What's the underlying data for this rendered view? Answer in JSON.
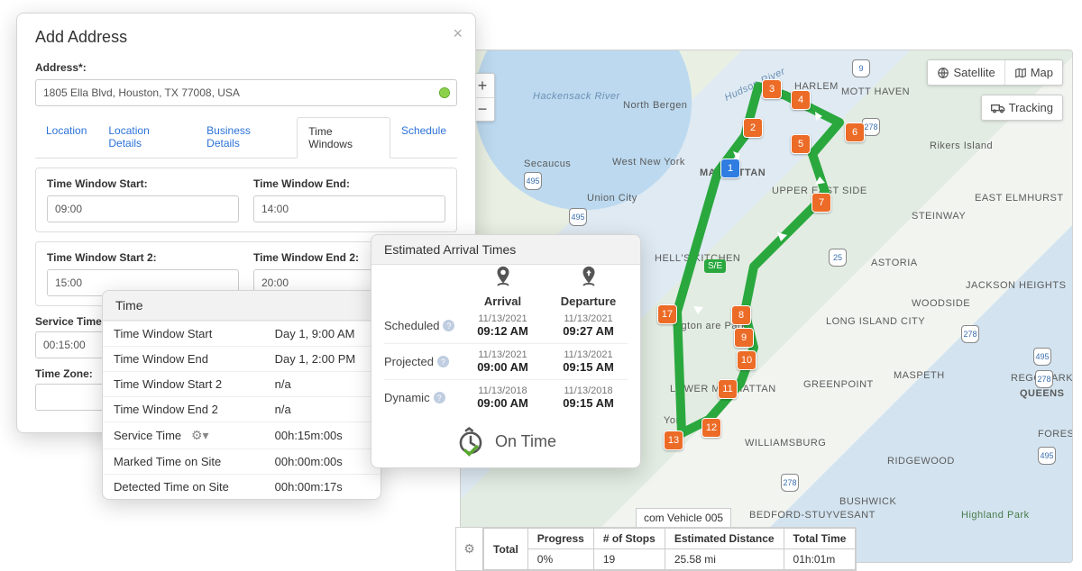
{
  "modal": {
    "title": "Add Address",
    "address_label": "Address*:",
    "address_value": "1805 Ella Blvd, Houston, TX 77008, USA",
    "tabs": {
      "location": "Location",
      "location_details": "Location Details",
      "business_details": "Business Details",
      "time_windows": "Time Windows",
      "schedule": "Schedule"
    },
    "tw1": {
      "start_label": "Time Window Start:",
      "start_value": "09:00",
      "end_label": "Time Window End:",
      "end_value": "14:00"
    },
    "tw2": {
      "start_label": "Time Window Start 2:",
      "start_value": "15:00",
      "end_label": "Time Window End 2:",
      "end_value": "20:00"
    },
    "service_time_label": "Service Time (HH:MM:SS):",
    "service_time_value": "00:15:00",
    "time_zone_label": "Time Zone:"
  },
  "time_card": {
    "title": "Time",
    "rows": {
      "tw_start": {
        "label": "Time Window Start",
        "value": "Day 1, 9:00 AM"
      },
      "tw_end": {
        "label": "Time Window End",
        "value": "Day 1, 2:00 PM"
      },
      "tw_start2": {
        "label": "Time Window Start 2",
        "value": "n/a"
      },
      "tw_end2": {
        "label": "Time Window End 2",
        "value": "n/a"
      },
      "service": {
        "label": "Service Time",
        "value": "00h:15m:00s"
      },
      "marked": {
        "label": "Marked Time on Site",
        "value": "00h:00m:00s"
      },
      "detected": {
        "label": "Detected Time on Site",
        "value": "00h:00m:17s"
      }
    }
  },
  "eta": {
    "title": "Estimated Arrival Times",
    "arrival_label": "Arrival",
    "departure_label": "Departure",
    "scheduled_label": "Scheduled",
    "projected_label": "Projected",
    "dynamic_label": "Dynamic",
    "scheduled": {
      "arr_date": "11/13/2021",
      "arr_time": "09:12 AM",
      "dep_date": "11/13/2021",
      "dep_time": "09:27 AM"
    },
    "projected": {
      "arr_date": "11/13/2021",
      "arr_time": "09:00 AM",
      "dep_date": "11/13/2021",
      "dep_time": "09:15 AM"
    },
    "dynamic": {
      "arr_date": "11/13/2018",
      "arr_time": "09:00 AM",
      "dep_date": "11/13/2018",
      "dep_time": "09:15 AM"
    },
    "status": "On Time"
  },
  "map": {
    "satellite": "Satellite",
    "map": "Map",
    "tracking": "Tracking",
    "vehicle": "com Vehicle 005",
    "labels": {
      "hackensack": "Hackensack River",
      "north_bergen": "North Bergen",
      "secaucus": "Secaucus",
      "west_ny": "West New York",
      "union_city": "Union City",
      "manhattan": "MANHATTAN",
      "astoria": "ASTORIA",
      "queens": "QUEENS",
      "rikers": "Rikers Island",
      "licity": "LONG ISLAND CITY",
      "harlem": "HARLEM",
      "mott_haven": "MOTT HAVEN",
      "east_elm": "EAST ELMHURST",
      "steinway": "STEINWAY",
      "jackson": "JACKSON HEIGHTS",
      "woodside": "WOODSIDE",
      "williamsburg": "WILLIAMSBURG",
      "ridgewood": "RIDGEWOOD",
      "maspeth": "MASPETH",
      "greenpoint": "GREENPOINT",
      "lower_man": "LOWER MANHATTAN",
      "york": "York",
      "hells_kitchen": "HELL'S KITCHEN",
      "upper_east": "UPPER EAST SIDE",
      "hudson": "Hudson River",
      "ington_park": "ington are Park",
      "bed_stuy": "BEDFORD-STUYVESANT",
      "bushwick": "BUSHWICK",
      "hp": "Highland Park",
      "forest": "FOREST",
      "rego": "REGO PARK"
    },
    "stops": {
      "1": "1",
      "2": "2",
      "3": "3",
      "4": "4",
      "5": "5",
      "6": "6",
      "7": "7",
      "8": "8",
      "9": "9",
      "10": "10",
      "11": "11",
      "12": "12",
      "13": "13",
      "17": "17",
      "se": "S/E"
    }
  },
  "summary": {
    "total_label": "Total",
    "headers": {
      "progress": "Progress",
      "stops": "# of Stops",
      "dist": "Estimated Distance",
      "time": "Total Time"
    },
    "values": {
      "progress": "0%",
      "stops": "19",
      "dist": "25.58 mi",
      "time": "01h:01m"
    }
  },
  "shields": {
    "s1": "9",
    "s2": "495",
    "s3": "495",
    "s4": "278",
    "s5": "278",
    "s6": "495",
    "s7": "278",
    "s8": "495",
    "s9": "278",
    "s10": "25"
  }
}
